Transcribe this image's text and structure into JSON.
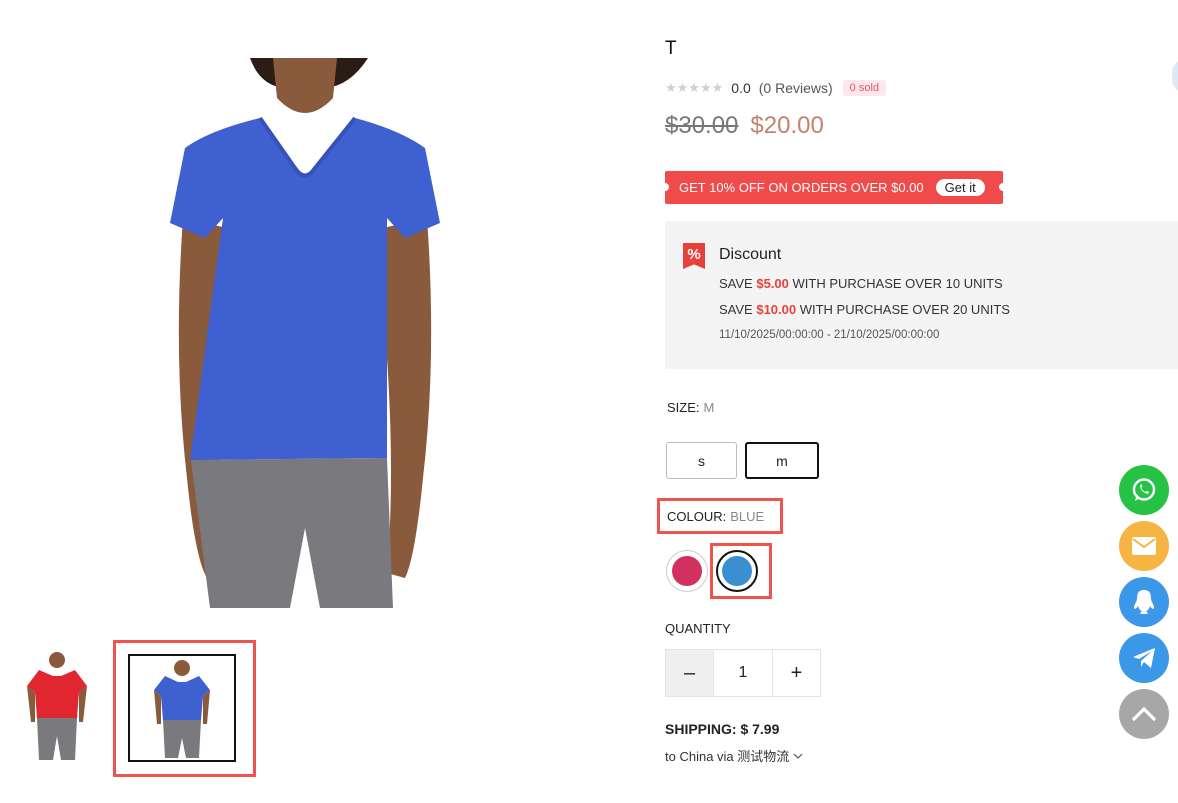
{
  "product": {
    "title": "T",
    "rating": "0.0",
    "reviews": "(0 Reviews)",
    "sold": "0 sold",
    "rating_stars": 0,
    "old_price": "$30.00",
    "price": "$20.00"
  },
  "coupon": {
    "text": "GET 10% OFF ON ORDERS OVER $0.00",
    "button": "Get it"
  },
  "discount": {
    "title": "Discount",
    "icon": "percent-icon",
    "lines": [
      {
        "prefix": "SAVE",
        "amount": "$5.00",
        "suffix": "WITH PURCHASE OVER 10 UNITS"
      },
      {
        "prefix": "SAVE",
        "amount": "$10.00",
        "suffix": "WITH PURCHASE OVER 20 UNITS"
      }
    ],
    "dates": "11/10/2025/00:00:00 - 21/10/2025/00:00:00"
  },
  "size": {
    "label": "SIZE:",
    "selected": "M",
    "options": [
      "s",
      "m"
    ]
  },
  "colour": {
    "label": "COLOUR:",
    "selected": "BLUE",
    "options": [
      {
        "name": "red-swatch",
        "color": "#d2305e"
      },
      {
        "name": "blue-swatch",
        "color": "#3a8fd0"
      }
    ]
  },
  "quantity": {
    "label": "QUANTITY",
    "value": "1",
    "minus": "–",
    "plus": "+"
  },
  "shipping": {
    "label": "SHIPPING: $ 7.99",
    "destination": "to China via 测试物流"
  },
  "colors": {
    "accent_red": "#f04a4a",
    "price": "#c5826b",
    "highlight": "#ef5350",
    "shirt_blue": "#3f60d0",
    "shirt_red": "#e0262f"
  },
  "fabs": [
    "whatsapp-icon",
    "mail-icon",
    "qq-icon",
    "telegram-icon",
    "scroll-top-icon"
  ]
}
